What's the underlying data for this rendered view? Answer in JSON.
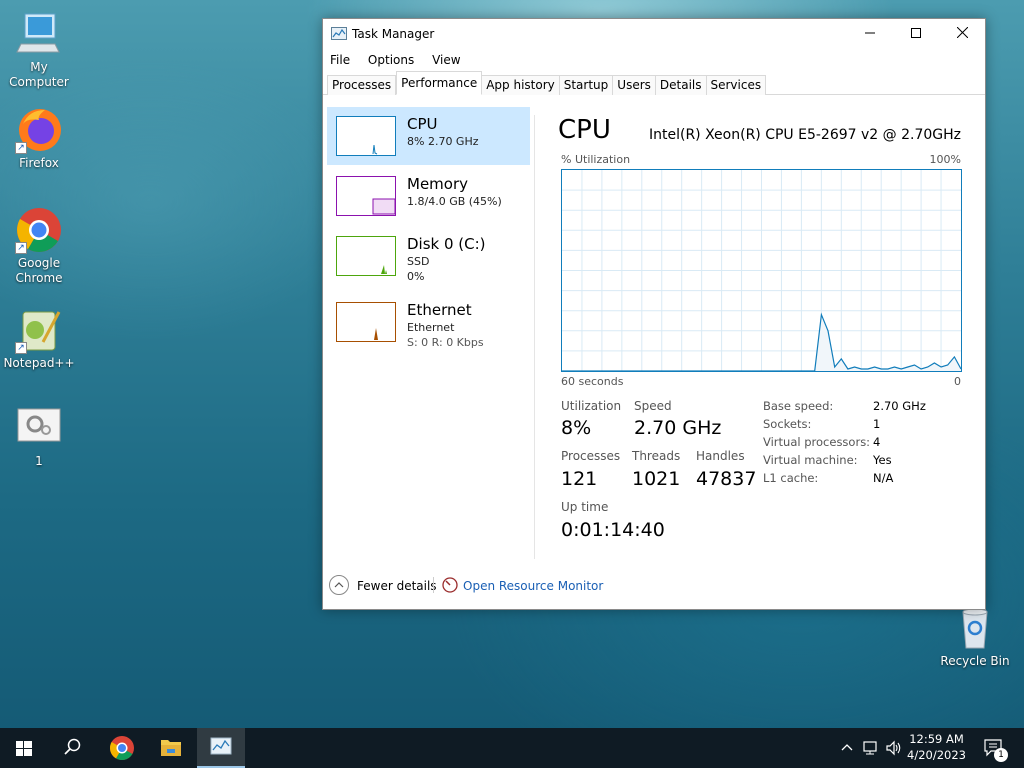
{
  "desktop": {
    "icons": [
      {
        "label": "My Computer"
      },
      {
        "label": "Firefox"
      },
      {
        "label": "Google Chrome"
      },
      {
        "label": "Notepad++"
      },
      {
        "label": "1"
      },
      {
        "label": "Recycle Bin"
      }
    ]
  },
  "window": {
    "title": "Task Manager",
    "menu": [
      "File",
      "Options",
      "View"
    ],
    "tabs": [
      "Processes",
      "Performance",
      "App history",
      "Startup",
      "Users",
      "Details",
      "Services"
    ],
    "active_tab": "Performance"
  },
  "sidebar": {
    "items": [
      {
        "title": "CPU",
        "line1": "8% 2.70 GHz",
        "line2": "",
        "color": "#117dbb"
      },
      {
        "title": "Memory",
        "line1": "1.8/4.0 GB (45%)",
        "line2": "",
        "color": "#8b12ae"
      },
      {
        "title": "Disk 0 (C:)",
        "line1": "SSD",
        "line2": "0%",
        "color": "#4da60c"
      },
      {
        "title": "Ethernet",
        "line1": "Ethernet",
        "line2": "S: 0 R: 0 Kbps",
        "color": "#a74f01"
      }
    ]
  },
  "cpu": {
    "title": "CPU",
    "model": "Intel(R) Xeon(R) CPU E5-2697 v2 @ 2.70GHz",
    "graph_top_left": "% Utilization",
    "graph_top_right": "100%",
    "graph_bottom_left": "60 seconds",
    "graph_bottom_right": "0",
    "utilization_history": [
      0,
      0,
      0,
      0,
      0,
      0,
      0,
      0,
      0,
      0,
      0,
      0,
      0,
      0,
      0,
      0,
      0,
      0,
      0,
      0,
      0,
      0,
      0,
      0,
      0,
      0,
      0,
      0,
      0,
      0,
      0,
      0,
      0,
      0,
      0,
      0,
      0,
      0,
      0,
      28,
      20,
      2,
      6,
      1,
      2,
      1,
      1,
      2,
      1,
      1,
      2,
      1,
      2,
      3,
      1,
      2,
      4,
      2,
      3,
      7,
      1
    ]
  },
  "stats": {
    "utilization_label": "Utilization",
    "utilization_value": "8%",
    "speed_label": "Speed",
    "speed_value": "2.70 GHz",
    "processes_label": "Processes",
    "processes_value": "121",
    "threads_label": "Threads",
    "threads_value": "1021",
    "handles_label": "Handles",
    "handles_value": "47837",
    "uptime_label": "Up time",
    "uptime_value": "0:01:14:40"
  },
  "info": [
    {
      "label": "Base speed:",
      "value": "2.70 GHz"
    },
    {
      "label": "Sockets:",
      "value": "1"
    },
    {
      "label": "Virtual processors:",
      "value": "4"
    },
    {
      "label": "Virtual machine:",
      "value": "Yes"
    },
    {
      "label": "L1 cache:",
      "value": "N/A"
    }
  ],
  "footer": {
    "fewer_details": "Fewer details",
    "resource_monitor": "Open Resource Monitor"
  },
  "taskbar": {
    "time": "12:59 AM",
    "date": "4/20/2023",
    "notification_count": "1"
  }
}
